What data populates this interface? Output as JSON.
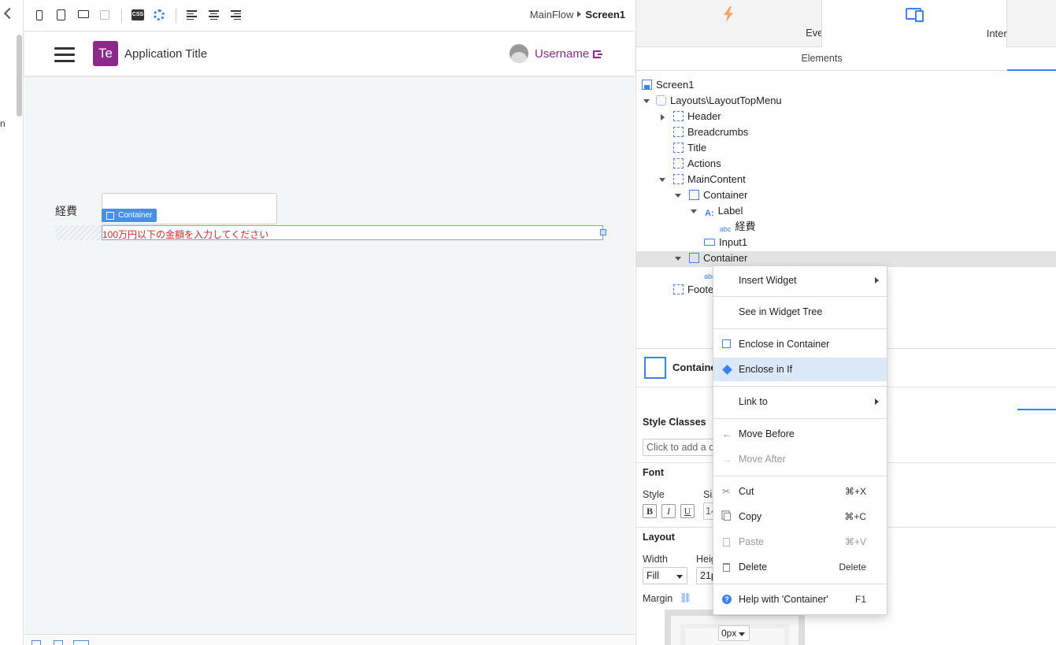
{
  "gutter": {
    "partial_text": "n"
  },
  "toolbar": {
    "css_label": "CSS",
    "breadcrumb": {
      "flow": "MainFlow",
      "screen": "Screen1"
    }
  },
  "app": {
    "logo_text": "Te",
    "title": "Application Title",
    "username": "Username",
    "brand_color": "#8b2a8b"
  },
  "form": {
    "label": "経費",
    "container_tag": "Container",
    "validation_text": "100万円以下の金額を入力してください",
    "validation_color": "#d42a2a"
  },
  "right_panel": {
    "tabs": [
      {
        "label": "Events"
      },
      {
        "label": "Interface"
      }
    ],
    "subtab": "Elements",
    "tree": {
      "screen1": "Screen1",
      "layout": "Layouts\\LayoutTopMenu",
      "header": "Header",
      "breadcrumbs": "Breadcrumbs",
      "title": "Title",
      "actions": "Actions",
      "maincontent": "MainContent",
      "container1": "Container",
      "label": "Label",
      "label_text": "経費",
      "input1": "Input1",
      "container2": "Container",
      "abc_partial": "abc",
      "footer_partial": "Foote"
    },
    "props": {
      "widget_name": "Containe",
      "style_classes": "Style Classes",
      "style_placeholder": "Click to add a cl",
      "font": "Font",
      "style": "Style",
      "size_partial": "Siz",
      "size_value_partial": "14",
      "bold": "B",
      "italic": "I",
      "underline": "U",
      "layout": "Layout",
      "width": "Width",
      "width_value": "Fill",
      "height_partial": "Heig",
      "height_value_partial": "21p",
      "margin": "Margin",
      "margin_value": "0px"
    }
  },
  "context_menu": {
    "items": [
      {
        "label": "Insert Widget",
        "submenu": true
      },
      {
        "label": "See in Widget Tree"
      },
      {
        "label": "Enclose in Container"
      },
      {
        "label": "Enclose in If",
        "highlighted": true
      },
      {
        "label": "Link to",
        "submenu": true
      },
      {
        "label": "Move Before"
      },
      {
        "label": "Move After",
        "disabled": true
      },
      {
        "label": "Cut",
        "shortcut": "⌘+X"
      },
      {
        "label": "Copy",
        "shortcut": "⌘+C"
      },
      {
        "label": "Paste",
        "shortcut": "⌘+V",
        "disabled": true
      },
      {
        "label": "Delete",
        "shortcut": "Delete"
      },
      {
        "label": "Help with 'Container'",
        "shortcut": "F1"
      }
    ]
  },
  "colors": {
    "accent": "#3b82f6",
    "highlight": "#dbe8f8"
  }
}
